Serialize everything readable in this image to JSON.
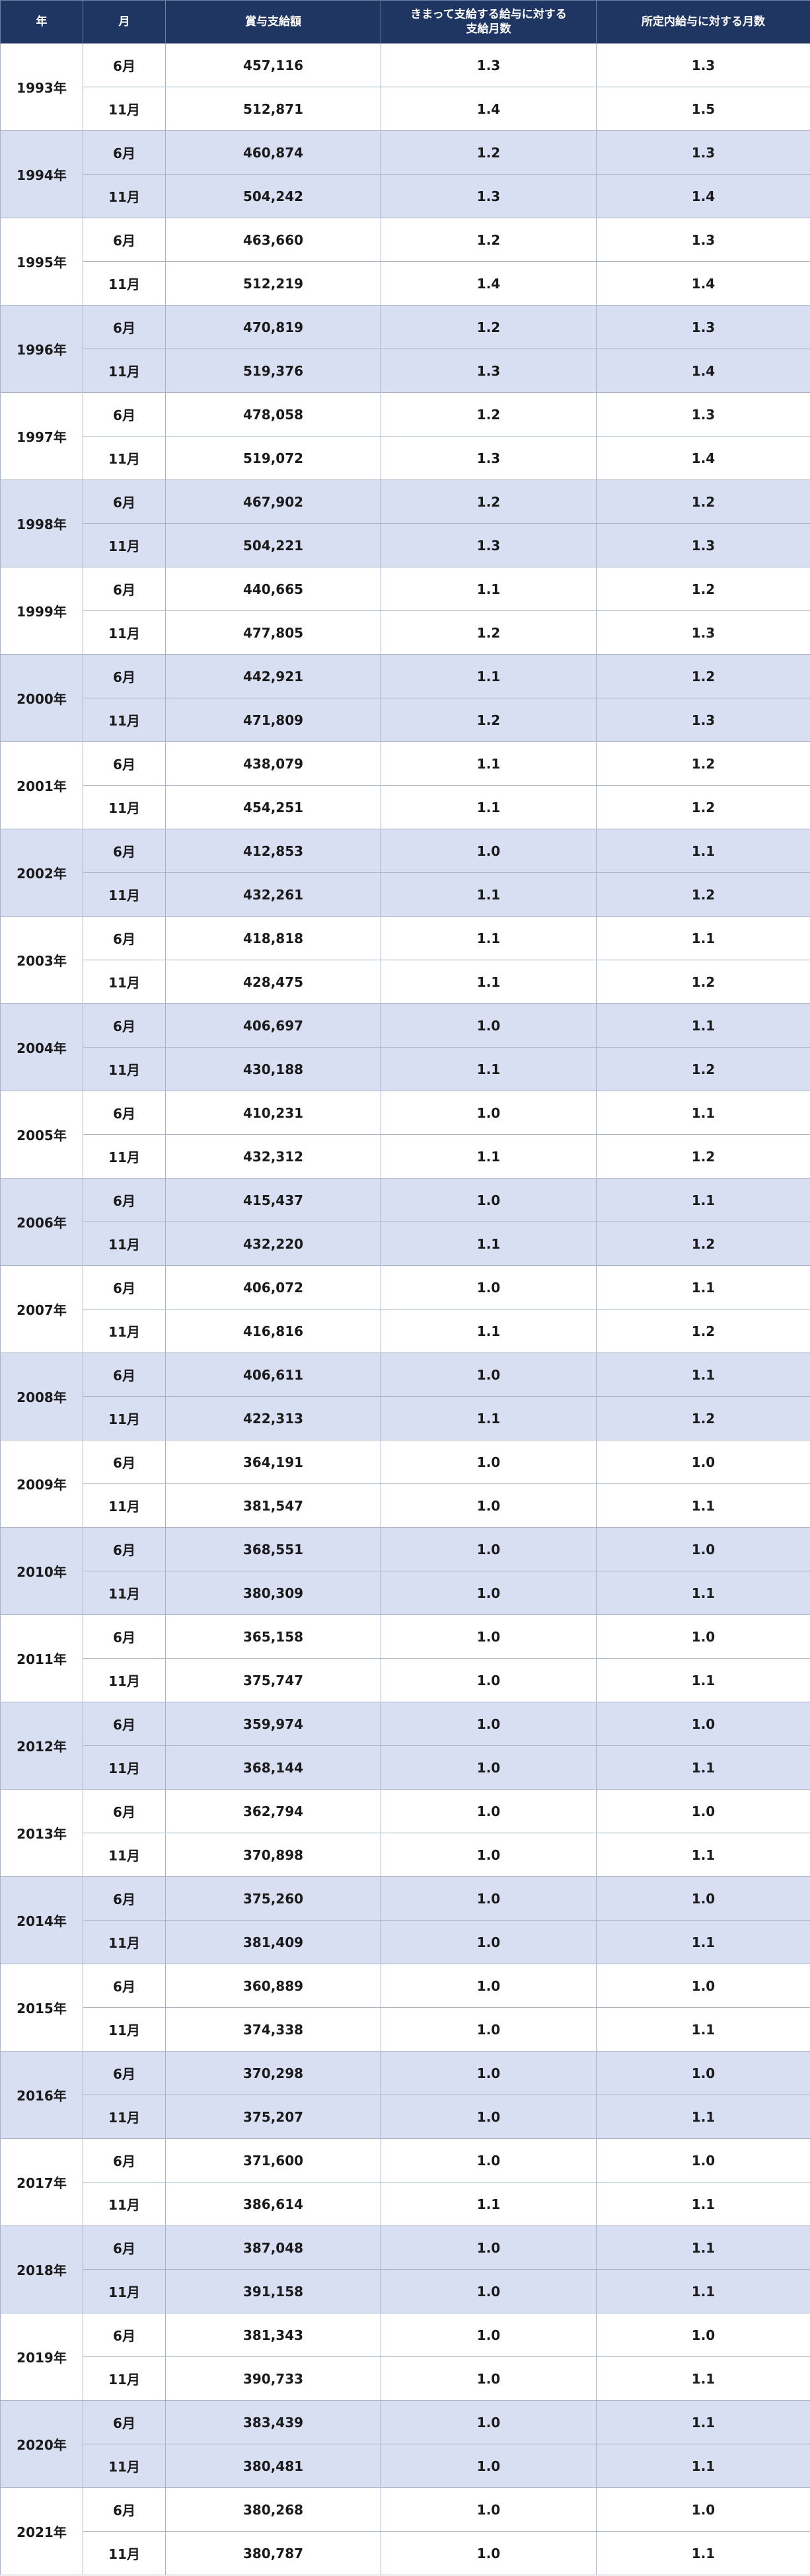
{
  "header": {
    "year": "年",
    "month": "月",
    "amount": "賞与支給額",
    "kimatte_line1": "きまって支給する給与に対する",
    "kimatte_line2": "支給月数",
    "shotei": "所定内給与に対する月数"
  },
  "colors": {
    "header_bg": "#1f3663",
    "header_text": "#ffffff",
    "alt_row_bg": "#d9dff2",
    "plain_row_bg": "#ffffff"
  },
  "years": [
    {
      "year": "1993年",
      "rows": [
        {
          "month": "6月",
          "amount": "457,116",
          "kimatte": "1.3",
          "shotei": "1.3"
        },
        {
          "month": "11月",
          "amount": "512,871",
          "kimatte": "1.4",
          "shotei": "1.5"
        }
      ]
    },
    {
      "year": "1994年",
      "rows": [
        {
          "month": "6月",
          "amount": "460,874",
          "kimatte": "1.2",
          "shotei": "1.3"
        },
        {
          "month": "11月",
          "amount": "504,242",
          "kimatte": "1.3",
          "shotei": "1.4"
        }
      ]
    },
    {
      "year": "1995年",
      "rows": [
        {
          "month": "6月",
          "amount": "463,660",
          "kimatte": "1.2",
          "shotei": "1.3"
        },
        {
          "month": "11月",
          "amount": "512,219",
          "kimatte": "1.4",
          "shotei": "1.4"
        }
      ]
    },
    {
      "year": "1996年",
      "rows": [
        {
          "month": "6月",
          "amount": "470,819",
          "kimatte": "1.2",
          "shotei": "1.3"
        },
        {
          "month": "11月",
          "amount": "519,376",
          "kimatte": "1.3",
          "shotei": "1.4"
        }
      ]
    },
    {
      "year": "1997年",
      "rows": [
        {
          "month": "6月",
          "amount": "478,058",
          "kimatte": "1.2",
          "shotei": "1.3"
        },
        {
          "month": "11月",
          "amount": "519,072",
          "kimatte": "1.3",
          "shotei": "1.4"
        }
      ]
    },
    {
      "year": "1998年",
      "rows": [
        {
          "month": "6月",
          "amount": "467,902",
          "kimatte": "1.2",
          "shotei": "1.2"
        },
        {
          "month": "11月",
          "amount": "504,221",
          "kimatte": "1.3",
          "shotei": "1.3"
        }
      ]
    },
    {
      "year": "1999年",
      "rows": [
        {
          "month": "6月",
          "amount": "440,665",
          "kimatte": "1.1",
          "shotei": "1.2"
        },
        {
          "month": "11月",
          "amount": "477,805",
          "kimatte": "1.2",
          "shotei": "1.3"
        }
      ]
    },
    {
      "year": "2000年",
      "rows": [
        {
          "month": "6月",
          "amount": "442,921",
          "kimatte": "1.1",
          "shotei": "1.2"
        },
        {
          "month": "11月",
          "amount": "471,809",
          "kimatte": "1.2",
          "shotei": "1.3"
        }
      ]
    },
    {
      "year": "2001年",
      "rows": [
        {
          "month": "6月",
          "amount": "438,079",
          "kimatte": "1.1",
          "shotei": "1.2"
        },
        {
          "month": "11月",
          "amount": "454,251",
          "kimatte": "1.1",
          "shotei": "1.2"
        }
      ]
    },
    {
      "year": "2002年",
      "rows": [
        {
          "month": "6月",
          "amount": "412,853",
          "kimatte": "1.0",
          "shotei": "1.1"
        },
        {
          "month": "11月",
          "amount": "432,261",
          "kimatte": "1.1",
          "shotei": "1.2"
        }
      ]
    },
    {
      "year": "2003年",
      "rows": [
        {
          "month": "6月",
          "amount": "418,818",
          "kimatte": "1.1",
          "shotei": "1.1"
        },
        {
          "month": "11月",
          "amount": "428,475",
          "kimatte": "1.1",
          "shotei": "1.2"
        }
      ]
    },
    {
      "year": "2004年",
      "rows": [
        {
          "month": "6月",
          "amount": "406,697",
          "kimatte": "1.0",
          "shotei": "1.1"
        },
        {
          "month": "11月",
          "amount": "430,188",
          "kimatte": "1.1",
          "shotei": "1.2"
        }
      ]
    },
    {
      "year": "2005年",
      "rows": [
        {
          "month": "6月",
          "amount": "410,231",
          "kimatte": "1.0",
          "shotei": "1.1"
        },
        {
          "month": "11月",
          "amount": "432,312",
          "kimatte": "1.1",
          "shotei": "1.2"
        }
      ]
    },
    {
      "year": "2006年",
      "rows": [
        {
          "month": "6月",
          "amount": "415,437",
          "kimatte": "1.0",
          "shotei": "1.1"
        },
        {
          "month": "11月",
          "amount": "432,220",
          "kimatte": "1.1",
          "shotei": "1.2"
        }
      ]
    },
    {
      "year": "2007年",
      "rows": [
        {
          "month": "6月",
          "amount": "406,072",
          "kimatte": "1.0",
          "shotei": "1.1"
        },
        {
          "month": "11月",
          "amount": "416,816",
          "kimatte": "1.1",
          "shotei": "1.2"
        }
      ]
    },
    {
      "year": "2008年",
      "rows": [
        {
          "month": "6月",
          "amount": "406,611",
          "kimatte": "1.0",
          "shotei": "1.1"
        },
        {
          "month": "11月",
          "amount": "422,313",
          "kimatte": "1.1",
          "shotei": "1.2"
        }
      ]
    },
    {
      "year": "2009年",
      "rows": [
        {
          "month": "6月",
          "amount": "364,191",
          "kimatte": "1.0",
          "shotei": "1.0"
        },
        {
          "month": "11月",
          "amount": "381,547",
          "kimatte": "1.0",
          "shotei": "1.1"
        }
      ]
    },
    {
      "year": "2010年",
      "rows": [
        {
          "month": "6月",
          "amount": "368,551",
          "kimatte": "1.0",
          "shotei": "1.0"
        },
        {
          "month": "11月",
          "amount": "380,309",
          "kimatte": "1.0",
          "shotei": "1.1"
        }
      ]
    },
    {
      "year": "2011年",
      "rows": [
        {
          "month": "6月",
          "amount": "365,158",
          "kimatte": "1.0",
          "shotei": "1.0"
        },
        {
          "month": "11月",
          "amount": "375,747",
          "kimatte": "1.0",
          "shotei": "1.1"
        }
      ]
    },
    {
      "year": "2012年",
      "rows": [
        {
          "month": "6月",
          "amount": "359,974",
          "kimatte": "1.0",
          "shotei": "1.0"
        },
        {
          "month": "11月",
          "amount": "368,144",
          "kimatte": "1.0",
          "shotei": "1.1"
        }
      ]
    },
    {
      "year": "2013年",
      "rows": [
        {
          "month": "6月",
          "amount": "362,794",
          "kimatte": "1.0",
          "shotei": "1.0"
        },
        {
          "month": "11月",
          "amount": "370,898",
          "kimatte": "1.0",
          "shotei": "1.1"
        }
      ]
    },
    {
      "year": "2014年",
      "rows": [
        {
          "month": "6月",
          "amount": "375,260",
          "kimatte": "1.0",
          "shotei": "1.0"
        },
        {
          "month": "11月",
          "amount": "381,409",
          "kimatte": "1.0",
          "shotei": "1.1"
        }
      ]
    },
    {
      "year": "2015年",
      "rows": [
        {
          "month": "6月",
          "amount": "360,889",
          "kimatte": "1.0",
          "shotei": "1.0"
        },
        {
          "month": "11月",
          "amount": "374,338",
          "kimatte": "1.0",
          "shotei": "1.1"
        }
      ]
    },
    {
      "year": "2016年",
      "rows": [
        {
          "month": "6月",
          "amount": "370,298",
          "kimatte": "1.0",
          "shotei": "1.0"
        },
        {
          "month": "11月",
          "amount": "375,207",
          "kimatte": "1.0",
          "shotei": "1.1"
        }
      ]
    },
    {
      "year": "2017年",
      "rows": [
        {
          "month": "6月",
          "amount": "371,600",
          "kimatte": "1.0",
          "shotei": "1.0"
        },
        {
          "month": "11月",
          "amount": "386,614",
          "kimatte": "1.1",
          "shotei": "1.1"
        }
      ]
    },
    {
      "year": "2018年",
      "rows": [
        {
          "month": "6月",
          "amount": "387,048",
          "kimatte": "1.0",
          "shotei": "1.1"
        },
        {
          "month": "11月",
          "amount": "391,158",
          "kimatte": "1.0",
          "shotei": "1.1"
        }
      ]
    },
    {
      "year": "2019年",
      "rows": [
        {
          "month": "6月",
          "amount": "381,343",
          "kimatte": "1.0",
          "shotei": "1.0"
        },
        {
          "month": "11月",
          "amount": "390,733",
          "kimatte": "1.0",
          "shotei": "1.1"
        }
      ]
    },
    {
      "year": "2020年",
      "rows": [
        {
          "month": "6月",
          "amount": "383,439",
          "kimatte": "1.0",
          "shotei": "1.1"
        },
        {
          "month": "11月",
          "amount": "380,481",
          "kimatte": "1.0",
          "shotei": "1.1"
        }
      ]
    },
    {
      "year": "2021年",
      "rows": [
        {
          "month": "6月",
          "amount": "380,268",
          "kimatte": "1.0",
          "shotei": "1.0"
        },
        {
          "month": "11月",
          "amount": "380,787",
          "kimatte": "1.0",
          "shotei": "1.1"
        }
      ]
    }
  ]
}
